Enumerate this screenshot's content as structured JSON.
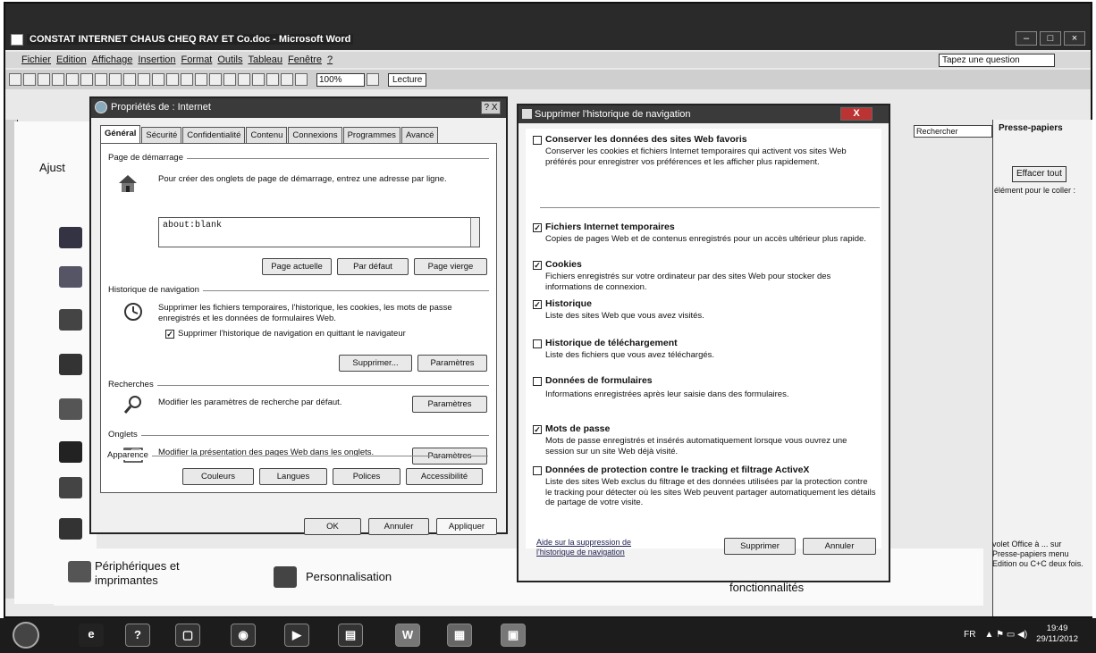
{
  "word": {
    "title": "CONSTAT INTERNET CHAUS CHEQ RAY ET Co.doc - Microsoft Word",
    "menu": [
      "Fichier",
      "Edition",
      "Affichage",
      "Insertion",
      "Format",
      "Outils",
      "Tableau",
      "Fenêtre",
      "?"
    ],
    "question_placeholder": "Tapez une question",
    "zoom": "100%",
    "lecture": "Lecture"
  },
  "control_panel": {
    "ajust": "Ajust",
    "peripheriques": "Périphériques et imprimantes",
    "personnalisation": "Personnalisation",
    "fonctionnalites": "fonctionnalités"
  },
  "task_pane": {
    "rechercher": "Rechercher",
    "presse_papiers": "Presse-papiers",
    "effacer_tout": "Effacer tout",
    "hint": "élément pour le coller :",
    "bottom_text": "volet Office à ... sur Presse-papiers menu Edition ou C+C deux fois."
  },
  "inet": {
    "title": "Propriétés de : Internet",
    "close": "?  X",
    "tabs": [
      "Général",
      "Sécurité",
      "Confidentialité",
      "Contenu",
      "Connexions",
      "Programmes",
      "Avancé"
    ],
    "home": {
      "group": "Page de démarrage",
      "desc": "Pour créer des onglets de page de démarrage, entrez une adresse par ligne.",
      "url": "about:blank",
      "btn_current": "Page actuelle",
      "btn_default": "Par défaut",
      "btn_blank": "Page vierge"
    },
    "history": {
      "group": "Historique de navigation",
      "desc": "Supprimer les fichiers temporaires, l'historique, les cookies, les mots de passe enregistrés et les données de formulaires Web.",
      "checkbox": "Supprimer l'historique de navigation en quittant le navigateur",
      "btn_delete": "Supprimer...",
      "btn_settings": "Paramètres"
    },
    "search": {
      "group": "Recherches",
      "desc": "Modifier les paramètres de recherche par défaut.",
      "btn_settings": "Paramètres"
    },
    "tabs_group": {
      "group": "Onglets",
      "desc": "Modifier la présentation des pages Web dans les onglets.",
      "btn_settings": "Paramètres"
    },
    "appearance": {
      "group": "Apparence",
      "btn_colors": "Couleurs",
      "btn_languages": "Langues",
      "btn_fonts": "Polices",
      "btn_access": "Accessibilité"
    },
    "footer": {
      "ok": "OK",
      "cancel": "Annuler",
      "apply": "Appliquer"
    }
  },
  "history_dialog": {
    "title": "Supprimer l'historique de navigation",
    "close": "X",
    "items": [
      {
        "label": "Conserver les données des sites Web favoris",
        "desc": "Conserver les cookies et fichiers Internet temporaires qui activent vos sites Web préférés pour enregistrer vos préférences et les afficher plus rapidement.",
        "checked": false
      },
      {
        "label": "Fichiers Internet temporaires",
        "desc": "Copies de pages Web et de contenus enregistrés pour un accès ultérieur plus rapide.",
        "checked": true
      },
      {
        "label": "Cookies",
        "desc": "Fichiers enregistrés sur votre ordinateur par des sites Web pour stocker des informations de connexion.",
        "checked": true
      },
      {
        "label": "Historique",
        "desc": "Liste des sites Web que vous avez visités.",
        "checked": true
      },
      {
        "label": "Historique de téléchargement",
        "desc": "Liste des fichiers que vous avez téléchargés.",
        "checked": false
      },
      {
        "label": "Données de formulaires",
        "desc": "Informations enregistrées après leur saisie dans des formulaires.",
        "checked": false
      },
      {
        "label": "Mots de passe",
        "desc": "Mots de passe enregistrés et insérés automatiquement lorsque vous ouvrez une session sur un site Web déjà visité.",
        "checked": true
      },
      {
        "label": "Données de protection contre le tracking et filtrage ActiveX",
        "desc": "Liste des sites Web exclus du filtrage et des données utilisées par la protection contre le tracking pour détecter où les sites Web peuvent partager automatiquement les détails de partage de votre visite.",
        "checked": false
      }
    ],
    "help_link": "Aide sur la suppression de l'historique de navigation",
    "btn_delete": "Supprimer",
    "btn_cancel": "Annuler"
  },
  "taskbar": {
    "lang": "FR",
    "time": "19:49",
    "date": "29/11/2012"
  }
}
